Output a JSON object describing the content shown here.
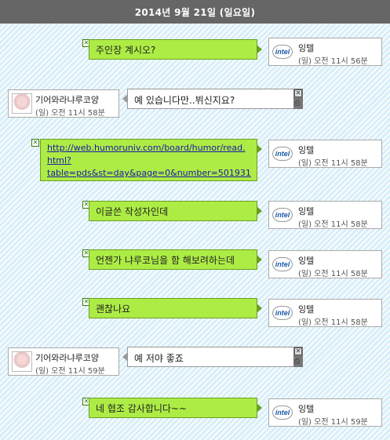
{
  "date_header": "2014년 9월 21일 (일요일)",
  "messages": [
    {
      "side": "out",
      "text": "주인장 계시오?",
      "sender": "잉텔",
      "time": "(일) 오전 11시 56분"
    },
    {
      "side": "in",
      "text": "예 있습니다만..뷔신지요?",
      "sender": "기어와라냐루코양",
      "time": "(일) 오전 11시 58분"
    },
    {
      "side": "out",
      "link_lines": [
        "http://web.humoruniv.com/board/humor/read.",
        "html?",
        "table=pds&st=day&page=0&number=501931"
      ],
      "sender": "잉텔",
      "time": "(일) 오전 11시 58분"
    },
    {
      "side": "out",
      "text": "이글쓴 작성자인데",
      "sender": "잉텔",
      "time": "(일) 오전 11시 58분"
    },
    {
      "side": "out",
      "text": "언젠가 냐루코님을 함 해보려하는데",
      "sender": "잉텔",
      "time": "(일) 오전 11시 58분"
    },
    {
      "side": "out",
      "text": "괜찮나요",
      "sender": "잉텔",
      "time": "(일) 오전 11시 58분"
    },
    {
      "side": "in",
      "text": "예 저야 좋죠",
      "sender": "기어와라냐루코양",
      "time": "(일) 오전 11시 59분"
    },
    {
      "side": "out",
      "text": "네 협조 감사합니다~~",
      "sender": "잉텔",
      "time": "(일) 오전 11시 59분"
    }
  ],
  "icons": {
    "delete": "close-x-icon",
    "intel_logo": "intel-logo-icon",
    "print": "print-icon"
  },
  "intel_logo_text": "intel",
  "colors": {
    "header_bg": "#666666",
    "bubble_out": "#adec45",
    "bubble_out_border": "#68a020",
    "link": "#1a1aa8"
  }
}
